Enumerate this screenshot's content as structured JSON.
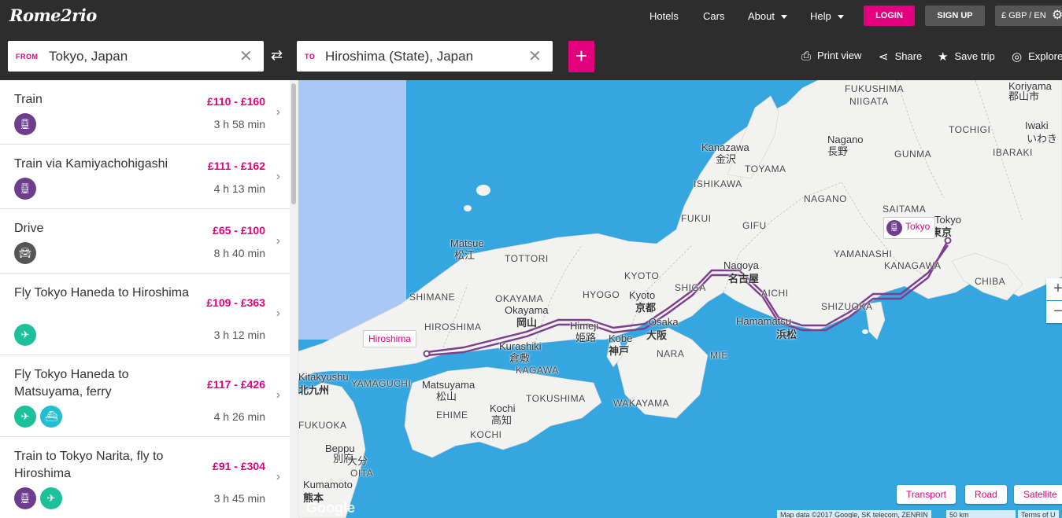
{
  "header": {
    "logo": "Rome2rio",
    "nav": {
      "hotels": "Hotels",
      "cars": "Cars",
      "about": "About",
      "help": "Help"
    },
    "login": "LOGIN",
    "signup": "SIGN UP",
    "currency": "£ GBP / EN"
  },
  "search": {
    "from_tag": "FROM",
    "from_value": "Tokyo, Japan",
    "to_tag": "TO",
    "to_value": "Hiroshima (State), Japan",
    "add_label": "+"
  },
  "tools": {
    "print": "Print view",
    "share": "Share",
    "save": "Save trip",
    "explore": "Explore"
  },
  "routes": [
    {
      "name": "Train",
      "price": "£110 - £160",
      "duration": "3 h 58 min",
      "modes": [
        "train"
      ]
    },
    {
      "name": "Train via Kamiyachohigashi",
      "price": "£111 - £162",
      "duration": "4 h 13 min",
      "modes": [
        "train"
      ]
    },
    {
      "name": "Drive",
      "price": "£65 - £100",
      "duration": "8 h 40 min",
      "modes": [
        "car"
      ]
    },
    {
      "name": "Fly Tokyo Haneda to Hiroshima",
      "price": "£109 - £363",
      "duration": "3 h 12 min",
      "modes": [
        "plane"
      ]
    },
    {
      "name": "Fly Tokyo Haneda to Matsuyama, ferry",
      "price": "£117 - £426",
      "duration": "4 h 26 min",
      "modes": [
        "plane",
        "ferry"
      ]
    },
    {
      "name": "Train to Tokyo Narita, fly to Hiroshima",
      "price": "£91 - £304",
      "duration": "3 h 45 min",
      "modes": [
        "train",
        "plane"
      ]
    }
  ],
  "map": {
    "pin_tokyo": "Tokyo",
    "pin_hiroshima": "Hiroshima",
    "labels": {
      "fukushima": "FUKUSHIMA",
      "niigata": "NIIGATA",
      "koriyama": "Koriyama",
      "koriyama_jp": "郡山市",
      "tochigi": "TOCHIGI",
      "iwaki": "Iwaki",
      "iwaki_jp": "いわき",
      "ibaraki": "IBARAKI",
      "nagano_city": "Nagano",
      "nagano_city_jp": "長野",
      "gunma": "GUNMA",
      "kanazawa": "Kanazawa",
      "kanazawa_jp": "金沢",
      "toyama": "TOYAMA",
      "ishikawa": "ISHIKAWA",
      "nagano": "NAGANO",
      "saitama": "SAITAMA",
      "tokyo": "Tokyo",
      "tokyo_jp": "東京",
      "fukui": "FUKUI",
      "gifu": "GIFU",
      "yamanashi": "YAMANASHI",
      "kanagawa": "KANAGAWA",
      "chiba": "CHIBA",
      "nagoya": "Nagoya",
      "nagoya_jp": "名古屋",
      "aichi": "AICHI",
      "shizuoka": "SHIZUOKA",
      "hamamatsu": "Hamamatsu",
      "hamamatsu_jp": "浜松",
      "matsue": "Matsue",
      "matsue_jp": "松江",
      "tottori": "TOTTORI",
      "shimane": "SHIMANE",
      "okayama_pref": "OKAYAMA",
      "okayama_city": "Okayama",
      "okayama_jp": "岡山",
      "hyogo": "HYOGO",
      "kyoto_pref": "KYOTO",
      "kyoto_city": "Kyoto",
      "kyoto_jp": "京都",
      "shiga": "SHIGA",
      "osaka": "Osaka",
      "osaka_jp": "大阪",
      "kobe": "Kobe",
      "kobe_jp": "神戸",
      "himeji": "Himeji",
      "himeji_jp": "姫路",
      "hiroshima_pref": "HIROSHIMA",
      "kurashiki": "Kurashiki",
      "kurashiki_jp": "倉敷",
      "nara": "NARA",
      "mie": "MIE",
      "kagawa": "KAGAWA",
      "tokushima": "TOKUSHIMA",
      "wakayama": "WAKAYAMA",
      "yamaguchi": "YAMAGUCHI",
      "matsuyama": "Matsuyama",
      "matsuyama_jp": "松山",
      "ehime": "EHIME",
      "kochi_city": "Kochi",
      "kochi_jp": "高知",
      "kochi": "KOCHI",
      "kitakyushu": "Kitakyushu",
      "kitakyushu_jp": "北九州",
      "fukuoka": "FUKUOKA",
      "beppu": "Beppu",
      "beppu_jp": "別府",
      "oita_city_jp": "大分",
      "oita": "OITA",
      "kumamoto": "Kumamoto",
      "kumamoto_jp": "熊本"
    },
    "buttons": {
      "transport": "Transport",
      "road": "Road",
      "satellite": "Satellite"
    },
    "zoom_in": "+",
    "zoom_out": "−",
    "attribution": "Map data ©2017 Google, SK telecom, ZENRIN",
    "scale": "50 km",
    "terms": "Terms of U",
    "google": "Google"
  },
  "colors": {
    "brand": "#e3007c",
    "route_line": "#7b3f8c",
    "sea": "#35a6e0",
    "land": "#f2f2f0"
  }
}
